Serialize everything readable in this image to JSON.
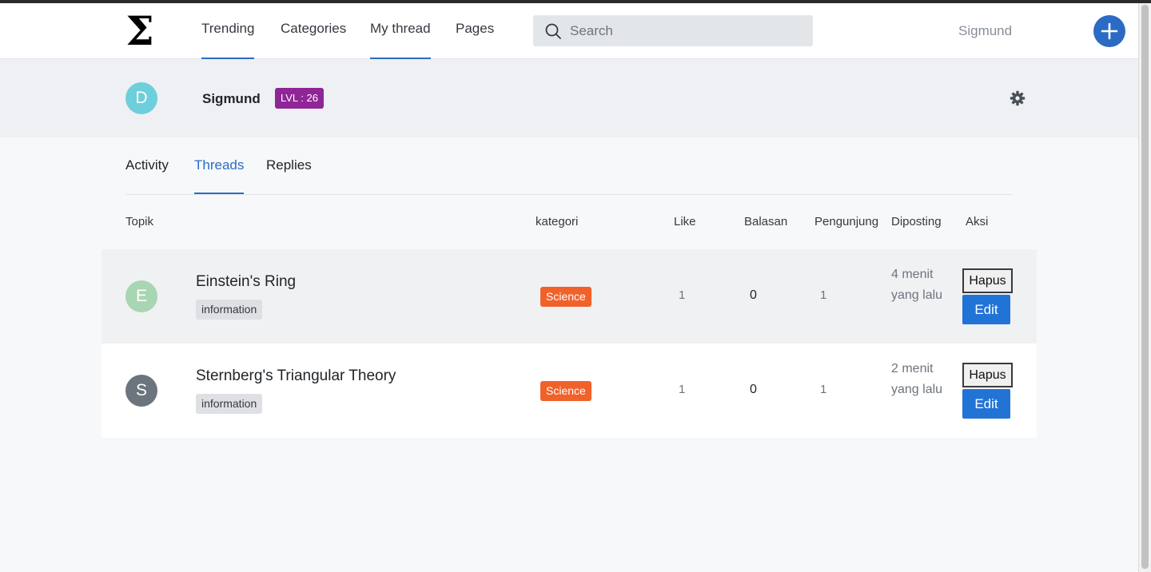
{
  "nav": {
    "logo": "Σ",
    "links": [
      "Trending",
      "Categories",
      "My thread",
      "Pages"
    ],
    "search_placeholder": "Search",
    "user": "Sigmund"
  },
  "profile": {
    "initial": "D",
    "name": "Sigmund",
    "level": "LVL : 26"
  },
  "tabs": [
    "Activity",
    "Threads",
    "Replies"
  ],
  "table": {
    "headers": [
      "Topik",
      "kategori",
      "Like",
      "Balasan",
      "Pengunjung",
      "Diposting",
      "Aksi"
    ],
    "rows": [
      {
        "initial": "E",
        "title": "Einstein's Ring",
        "tag": "information",
        "category": "Science",
        "likes": "1",
        "replies": "0",
        "visitors": "1",
        "posted": "4 menit yang lalu",
        "delete_label": "Hapus",
        "edit_label": "Edit"
      },
      {
        "initial": "S",
        "title": "Sternberg's Triangular Theory",
        "tag": "information",
        "category": "Science",
        "likes": "1",
        "replies": "0",
        "visitors": "1",
        "posted": "2 menit yang lalu",
        "delete_label": "Hapus",
        "edit_label": "Edit"
      }
    ]
  },
  "colors": {
    "accent": "#2c6bc4",
    "level_badge": "#8f2596",
    "category_badge": "#f0622a",
    "profile_avatar": "#6dcfdc",
    "avatar_e": "#a8d5b2",
    "avatar_s": "#6c757d"
  },
  "icons": {
    "search": "search-icon",
    "add": "plus-icon",
    "settings": "gear-icon"
  }
}
